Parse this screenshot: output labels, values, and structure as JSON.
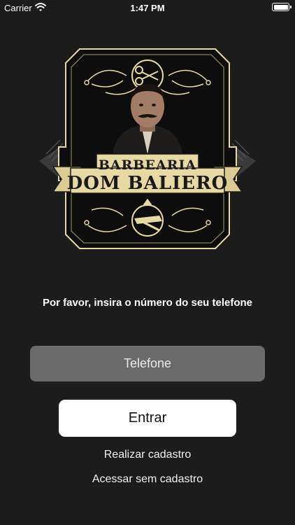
{
  "status_bar": {
    "carrier": "Carrier",
    "time": "1:47 PM"
  },
  "logo": {
    "line1": "BARBEARIA",
    "line2": "DOM BALIERO"
  },
  "prompt": "Por favor, insira o número do seu telefone",
  "phone_field": {
    "placeholder": "Telefone",
    "value": ""
  },
  "enter_button": "Entrar",
  "register_link": "Realizar cadastro",
  "guest_link": "Acessar sem cadastro",
  "colors": {
    "background": "#1c1c1c",
    "logo_gold": "#e7d9a3",
    "field": "#6b6b6b"
  }
}
